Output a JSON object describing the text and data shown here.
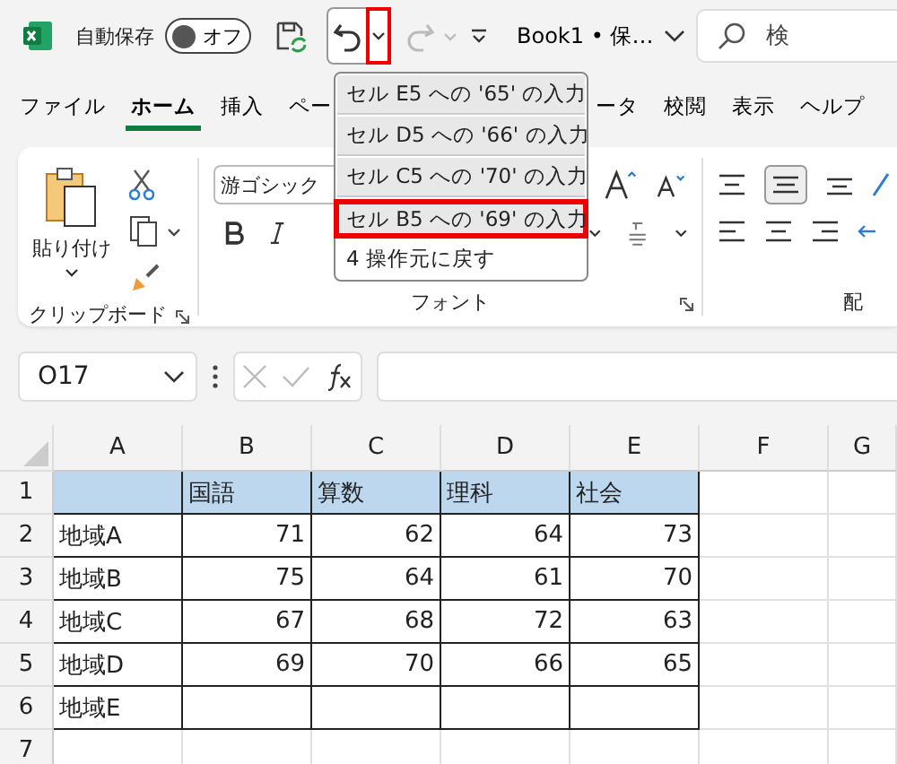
{
  "title_bar": {
    "autosave_label": "自動保存",
    "autosave_toggle": {
      "label": "オフ",
      "on": false
    },
    "undo_arrow_highlighted": true,
    "file_name": "Book1 • 保…",
    "search_placeholder": "検"
  },
  "undo_history": {
    "items": [
      {
        "label": "セル E5 への '65' の入力",
        "selected": true,
        "highlighted": false
      },
      {
        "label": "セル D5 への '66' の入力",
        "selected": true,
        "highlighted": false
      },
      {
        "label": "セル C5 への '70' の入力",
        "selected": true,
        "highlighted": false
      },
      {
        "label": "セル B5 への '69' の入力",
        "selected": true,
        "highlighted": true
      }
    ],
    "footer": "4 操作元に戻す"
  },
  "tabs": [
    {
      "label": "ファイル",
      "selected": false
    },
    {
      "label": "ホーム",
      "selected": true
    },
    {
      "label": "挿入",
      "selected": false
    },
    {
      "label": "ペー",
      "selected": false
    },
    {
      "label": "ータ",
      "selected": false
    },
    {
      "label": "校閲",
      "selected": false
    },
    {
      "label": "表示",
      "selected": false
    },
    {
      "label": "ヘルプ",
      "selected": false
    }
  ],
  "ribbon": {
    "paste_label": "貼り付け",
    "font_name": "游ゴシック",
    "groups": [
      "クリップボード",
      "フォント",
      "配"
    ]
  },
  "formula_bar": {
    "name_box": "O17"
  },
  "sheet": {
    "columns": [
      "A",
      "B",
      "C",
      "D",
      "E",
      "F",
      "G"
    ],
    "rows": [
      {
        "number": "1",
        "cells": [
          {
            "kind": "text",
            "filled": true
          },
          {
            "kind": "text",
            "text": "国語",
            "filled": true
          },
          {
            "kind": "text",
            "text": "算数",
            "filled": true
          },
          {
            "kind": "text",
            "text": "理科",
            "filled": true
          },
          {
            "kind": "text",
            "text": "社会",
            "filled": true
          }
        ]
      },
      {
        "number": "2",
        "cells": [
          {
            "kind": "text",
            "text": "地域A",
            "filled": false
          },
          {
            "kind": "number",
            "text": "71",
            "filled": false
          },
          {
            "kind": "number",
            "text": "62",
            "filled": false
          },
          {
            "kind": "number",
            "text": "64",
            "filled": false
          },
          {
            "kind": "number",
            "text": "73",
            "filled": false
          }
        ]
      },
      {
        "number": "3",
        "cells": [
          {
            "kind": "text",
            "text": "地域B",
            "filled": false
          },
          {
            "kind": "number",
            "text": "75",
            "filled": false
          },
          {
            "kind": "number",
            "text": "64",
            "filled": false
          },
          {
            "kind": "number",
            "text": "61",
            "filled": false
          },
          {
            "kind": "number",
            "text": "70",
            "filled": false
          }
        ]
      },
      {
        "number": "4",
        "cells": [
          {
            "kind": "text",
            "text": "地域C",
            "filled": false
          },
          {
            "kind": "number",
            "text": "67",
            "filled": false
          },
          {
            "kind": "number",
            "text": "68",
            "filled": false
          },
          {
            "kind": "number",
            "text": "72",
            "filled": false
          },
          {
            "kind": "number",
            "text": "63",
            "filled": false
          }
        ]
      },
      {
        "number": "5",
        "cells": [
          {
            "kind": "text",
            "text": "地域D",
            "filled": false
          },
          {
            "kind": "number",
            "text": "69",
            "filled": false
          },
          {
            "kind": "number",
            "text": "70",
            "filled": false
          },
          {
            "kind": "number",
            "text": "66",
            "filled": false
          },
          {
            "kind": "number",
            "text": "65",
            "filled": false
          }
        ]
      },
      {
        "number": "6",
        "cells": [
          {
            "kind": "text",
            "text": "地域E",
            "filled": false
          },
          {
            "kind": "number",
            "filled": false
          },
          {
            "kind": "number",
            "filled": false
          },
          {
            "kind": "number",
            "filled": false
          },
          {
            "kind": "number",
            "filled": false
          }
        ]
      },
      {
        "number": "7",
        "cells": []
      }
    ]
  }
}
